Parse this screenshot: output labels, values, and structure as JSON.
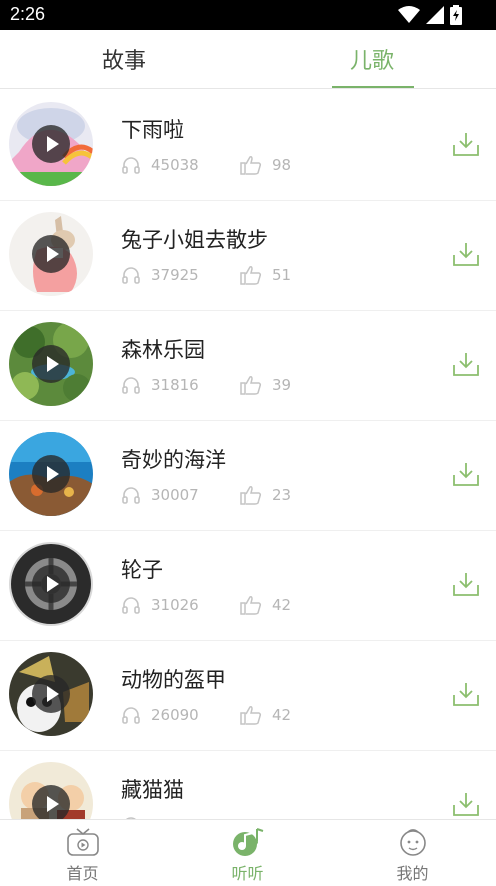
{
  "status_bar": {
    "time": "2:26"
  },
  "tabs": [
    {
      "label": "故事",
      "selected": false
    },
    {
      "label": "儿歌",
      "selected": true
    }
  ],
  "colors": {
    "accent": "#7ab36a",
    "stat_gray": "#b5b5b5"
  },
  "songs": [
    {
      "title": "下雨啦",
      "listens": "45038",
      "likes": "98",
      "thumb": "rain-rainbow"
    },
    {
      "title": "兔子小姐去散步",
      "listens": "37925",
      "likes": "51",
      "thumb": "rabbit-lady"
    },
    {
      "title": "森林乐园",
      "listens": "31816",
      "likes": "39",
      "thumb": "forest"
    },
    {
      "title": "奇妙的海洋",
      "listens": "30007",
      "likes": "23",
      "thumb": "ocean"
    },
    {
      "title": "轮子",
      "listens": "31026",
      "likes": "42",
      "thumb": "wheel"
    },
    {
      "title": "动物的盔甲",
      "listens": "26090",
      "likes": "42",
      "thumb": "panda-armor"
    },
    {
      "title": "藏猫猫",
      "listens": "",
      "likes": "",
      "thumb": "hide-and-seek"
    }
  ],
  "bottom_nav": [
    {
      "label": "首页",
      "icon": "tv-icon",
      "active": false
    },
    {
      "label": "听听",
      "icon": "music-note-icon",
      "active": true
    },
    {
      "label": "我的",
      "icon": "baby-face-icon",
      "active": false
    }
  ]
}
